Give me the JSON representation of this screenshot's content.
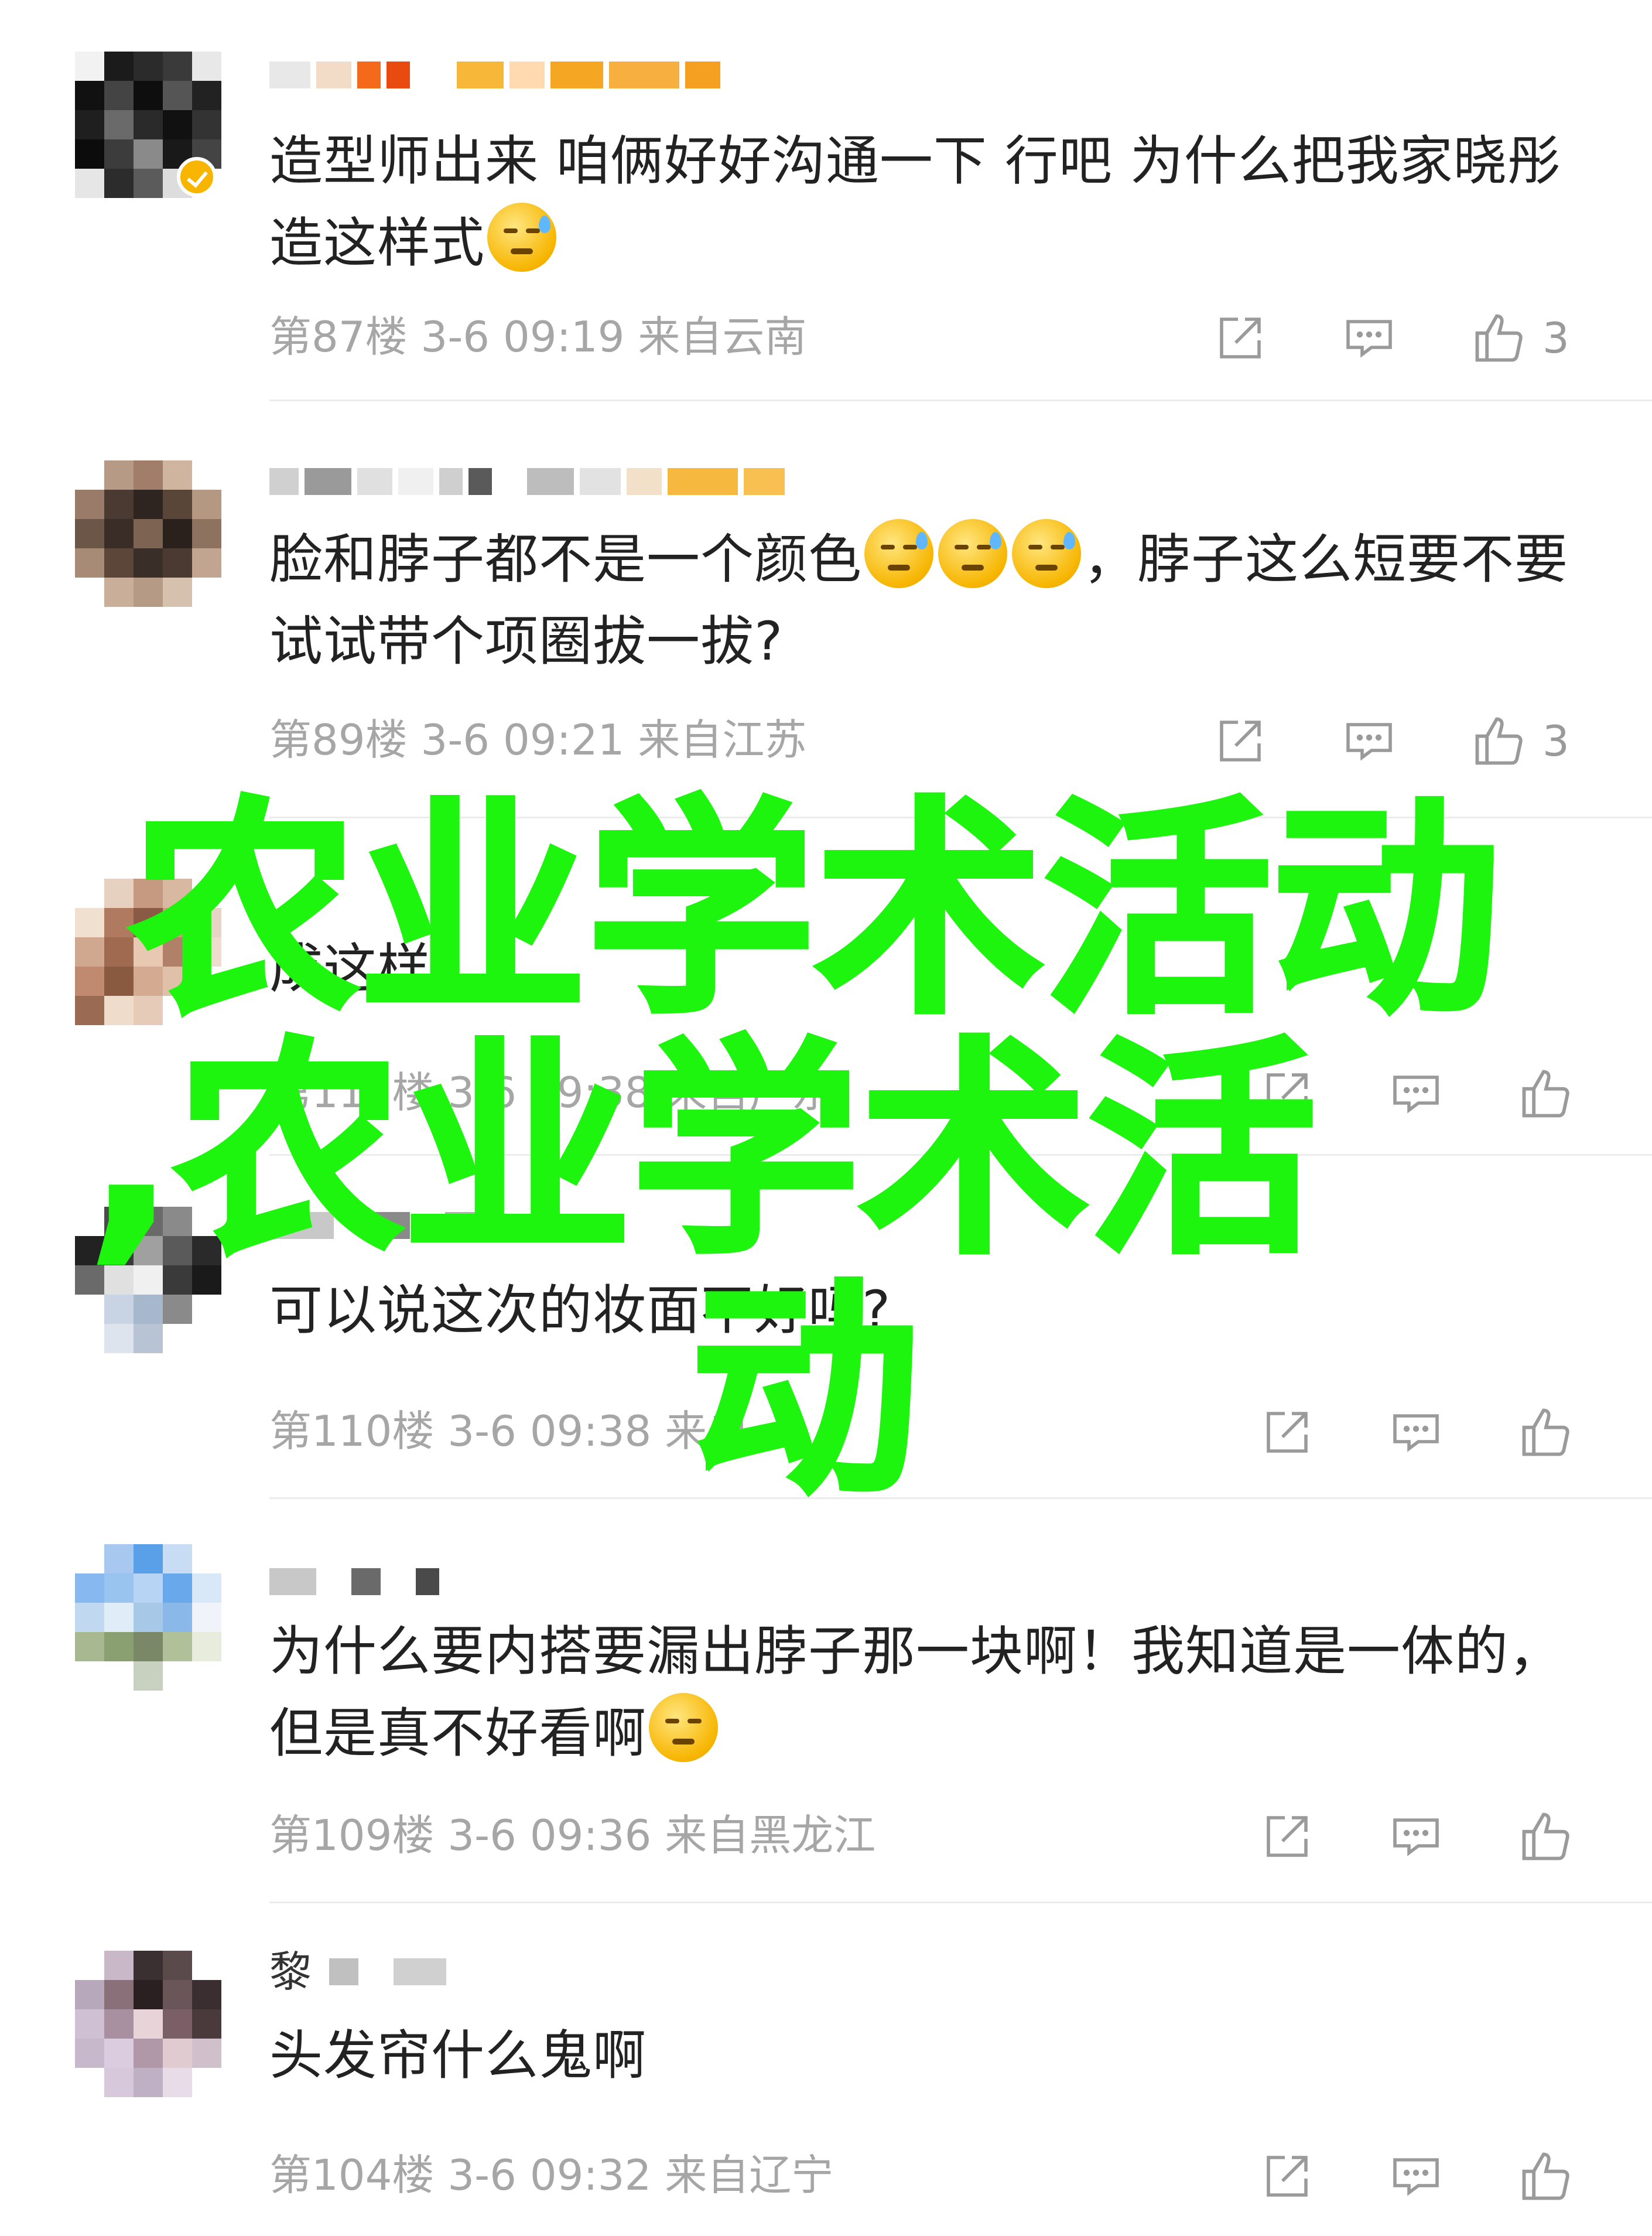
{
  "watermark": {
    "text": "农业学术活动,农业学术活动",
    "line1": "农业学术活动",
    "line2": ",农业学术活",
    "line3": "动",
    "color": "#1ef50f"
  },
  "icons": {
    "share": "share-icon",
    "reply": "reply-icon",
    "like": "thumbs-up-icon",
    "verified": "verified-badge-icon"
  },
  "comments": [
    {
      "text": "造型师出来 咱俩好好沟通一下 行吧 为什么把我家晓彤造这样式",
      "emoji": "crying-face-emoji",
      "floor": "第87楼",
      "time": "3-6 09:19",
      "location": "来自云南",
      "likes": "3"
    },
    {
      "text_a": "脸和脖子都不是一个颜色",
      "emojis": "sleepy-sweat-face-emoji ×3",
      "text_b": "，脖子这么短要不要试试带个项圈拔一拔?",
      "floor": "第89楼",
      "time": "3-6 09:21",
      "location": "来自江苏",
      "likes": "3"
    },
    {
      "text": "成这样",
      "floor": "第111楼",
      "time": "3-6 09:38",
      "location": "来自广东",
      "likes": ""
    },
    {
      "text": "可以说这次的妆面不好吗?",
      "floor": "第110楼",
      "time": "3-6 09:38",
      "location": "来自",
      "likes": ""
    },
    {
      "text": "为什么要内搭要漏出脖子那一块啊！我知道是一体的，但是真不好看啊",
      "emoji": "dizzy-face-emoji",
      "floor": "第109楼",
      "time": "3-6 09:36",
      "location": "来自黑龙江",
      "likes": ""
    },
    {
      "username_char": "黎",
      "text": "头发帘什么鬼啊",
      "floor": "第104楼",
      "time": "3-6 09:32",
      "location": "来自辽宁",
      "likes": ""
    }
  ]
}
